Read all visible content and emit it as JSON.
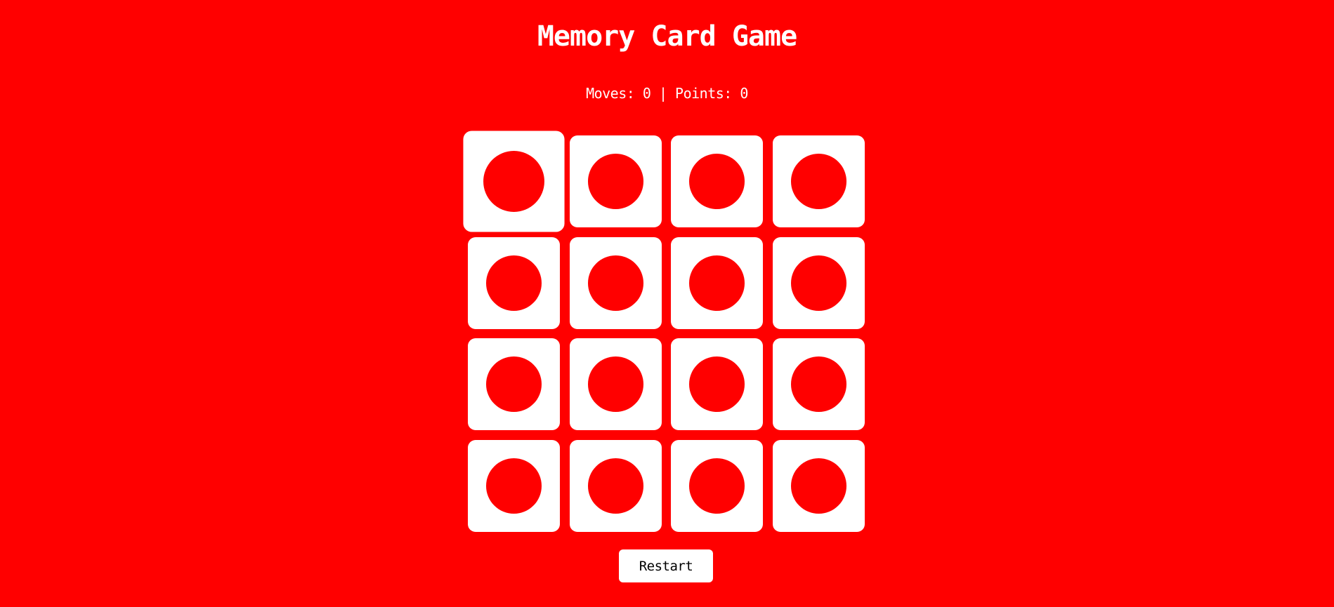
{
  "game": {
    "title": "Memory Card Game",
    "stats": {
      "moves_label": "Moves:",
      "moves": 0,
      "points_label": "Points:",
      "points": 0,
      "separator": "|"
    },
    "grid": {
      "rows": 4,
      "cols": 4
    },
    "cards_face_down": 16,
    "hovered_card_index": 0,
    "restart_label": "Restart"
  },
  "colors": {
    "background": "#ff0000",
    "card": "#ffffff",
    "card_dot": "#ff0000",
    "button_text": "#000000"
  }
}
